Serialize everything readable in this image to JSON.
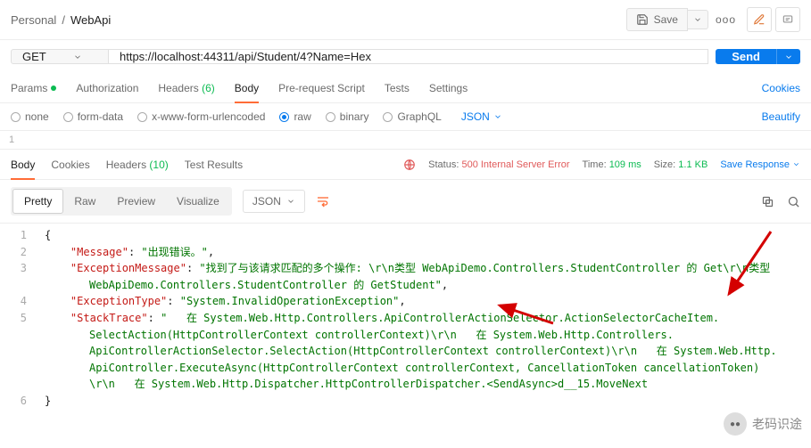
{
  "breadcrumb": {
    "root": "Personal",
    "sep": "/",
    "current": "WebApi"
  },
  "actions": {
    "save": "Save",
    "more": "ooo"
  },
  "request": {
    "method": "GET",
    "url": "https://localhost:44311/api/Student/4?Name=Hex",
    "send": "Send"
  },
  "reqTabs": {
    "params": "Params",
    "auth": "Authorization",
    "headers": "Headers",
    "headersCount": "(6)",
    "body": "Body",
    "prereq": "Pre-request Script",
    "tests": "Tests",
    "settings": "Settings",
    "cookies": "Cookies"
  },
  "bodyTypes": {
    "none": "none",
    "formdata": "form-data",
    "xwww": "x-www-form-urlencoded",
    "raw": "raw",
    "binary": "binary",
    "graphql": "GraphQL",
    "json": "JSON",
    "beautify": "Beautify"
  },
  "editorLine1": "1",
  "respTabs": {
    "body": "Body",
    "cookies": "Cookies",
    "headers": "Headers",
    "headersCount": "(10)",
    "testResults": "Test Results"
  },
  "status": {
    "label": "Status:",
    "code": "500 Internal Server Error",
    "timeLabel": "Time:",
    "time": "109 ms",
    "sizeLabel": "Size:",
    "size": "1.1 KB",
    "saveResponse": "Save Response"
  },
  "viewModes": {
    "pretty": "Pretty",
    "raw": "Raw",
    "preview": "Preview",
    "visualize": "Visualize",
    "format": "JSON"
  },
  "json": {
    "open": "{",
    "messageKey": "\"Message\"",
    "messageVal": "\"出现错误。\"",
    "exMsgKey": "\"ExceptionMessage\"",
    "exMsgVal1": "\"找到了与该请求匹配的多个操作: \\r\\n类型 WebApiDemo.Controllers.StudentController 的 Get\\r\\n类型",
    "exMsgVal2": "WebApiDemo.Controllers.StudentController 的 GetStudent\"",
    "exTypeKey": "\"ExceptionType\"",
    "exTypeVal": "\"System.InvalidOperationException\"",
    "stackKey": "\"StackTrace\"",
    "stackVal1": "\"   在 System.Web.Http.Controllers.ApiControllerActionSelector.ActionSelectorCacheItem.",
    "stackVal2": "SelectAction(HttpControllerContext controllerContext)\\r\\n   在 System.Web.Http.Controllers.",
    "stackVal3": "ApiControllerActionSelector.SelectAction(HttpControllerContext controllerContext)\\r\\n   在 System.Web.Http.",
    "stackVal4": "ApiController.ExecuteAsync(HttpControllerContext controllerContext, CancellationToken cancellationToken)",
    "stackVal5": "\\r\\n   在 System.Web.Http.Dispatcher.HttpControllerDispatcher.<SendAsync>d__15.MoveNext",
    "close": "}"
  },
  "lines": {
    "l1": "1",
    "l2": "2",
    "l3": "3",
    "l4": "4",
    "l5": "5",
    "l6": "6"
  },
  "watermark": "老码识途"
}
